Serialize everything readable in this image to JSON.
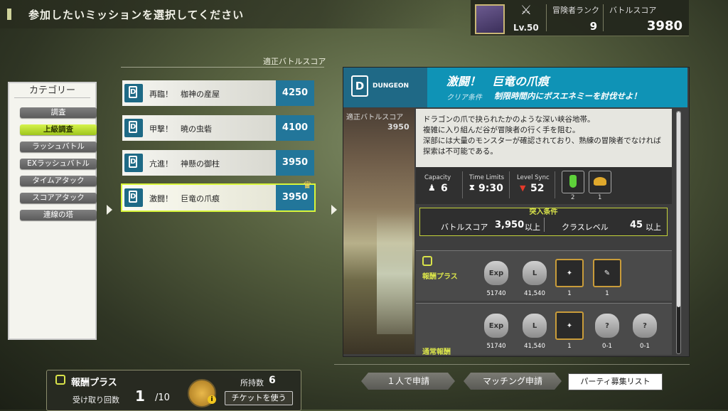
{
  "header": {
    "title": "参加したいミッションを選択してください"
  },
  "player": {
    "emblem_text": "冒険",
    "level": "Lv.50",
    "rank_label": "冒険者ランク",
    "rank_value": "9",
    "score_label": "バトルスコア",
    "score_value": "3980"
  },
  "category": {
    "title": "カテゴリー",
    "items": [
      {
        "label": "調査",
        "active": false
      },
      {
        "label": "上級調査",
        "active": true
      },
      {
        "label": "ラッシュバトル",
        "active": false
      },
      {
        "label": "EXラッシュバトル",
        "active": false
      },
      {
        "label": "タイムアタック",
        "active": false
      },
      {
        "label": "スコアアタック",
        "active": false
      },
      {
        "label": "連線の塔",
        "active": false
      }
    ]
  },
  "mission_list": {
    "header": "適正バトルスコア",
    "items": [
      {
        "name": "再臨！　枷神の産屋",
        "score": "4250",
        "selected": false
      },
      {
        "name": "甲撃！　暁の虫砦",
        "score": "4100",
        "selected": false
      },
      {
        "name": "亢進！　神懸の御柱",
        "score": "3950",
        "selected": false
      },
      {
        "name": "激闘！　巨竜の爪痕",
        "score": "3950",
        "selected": true
      }
    ]
  },
  "detail": {
    "type_label": "DUNGEON",
    "title": "激闘！　巨竜の爪痕",
    "clear_label": "クリア条件",
    "clear_text": "制限時間内にボスエネミーを討伐せよ！",
    "scene_score_label": "適正バトルスコア",
    "scene_score_value": "3950",
    "description": [
      "ドラゴンの爪で抉られたかのような深い峡谷地帯。",
      "複雑に入り組んだ谷が冒険者の行く手を阻む。",
      "深部には大量のモンスターが確認されており、熟練の冒険者でなければ",
      "探索は不可能である。"
    ],
    "capacity_label": "Capacity",
    "capacity_value": "6",
    "time_label": "Time Limits",
    "time_value": "9:30",
    "sync_label": "Level Sync",
    "sync_value": "52",
    "item_counts": [
      "2",
      "1"
    ],
    "requirements": {
      "title": "突入条件",
      "score_label": "バトルスコア",
      "score_value": "3,950",
      "score_unit": "以上",
      "class_label": "クラスレベル",
      "class_value": "45",
      "class_unit": "以上"
    },
    "reward_plus": {
      "label": "報酬プラス",
      "items": [
        {
          "icon": "Exp",
          "count": "51740"
        },
        {
          "icon": "L",
          "count": "41,540"
        },
        {
          "icon": "tank",
          "count": "1"
        },
        {
          "icon": "syringe",
          "count": "1"
        }
      ]
    },
    "reward_normal": {
      "label": "通常報酬",
      "items": [
        {
          "icon": "Exp",
          "count": "51740"
        },
        {
          "icon": "L",
          "count": "41,540"
        },
        {
          "icon": "tank",
          "count": "1"
        },
        {
          "icon": "?",
          "count": "0-1"
        },
        {
          "icon": "?",
          "count": "0-1"
        }
      ]
    }
  },
  "bottom": {
    "bonus_label": "報酬プラス",
    "receive_label": "受け取り回数",
    "receive_value": "1",
    "receive_max": "/10",
    "owned_label": "所持数",
    "owned_value": "6",
    "use_ticket": "チケットを使う",
    "solo_button": "１人で申請",
    "matching_button": "マッチング申請",
    "party_button": "パーティ募集リスト"
  },
  "colors": {
    "accent_blue": "#0f93b6",
    "accent_green": "#d6f34c",
    "score_blue": "#22769a"
  }
}
